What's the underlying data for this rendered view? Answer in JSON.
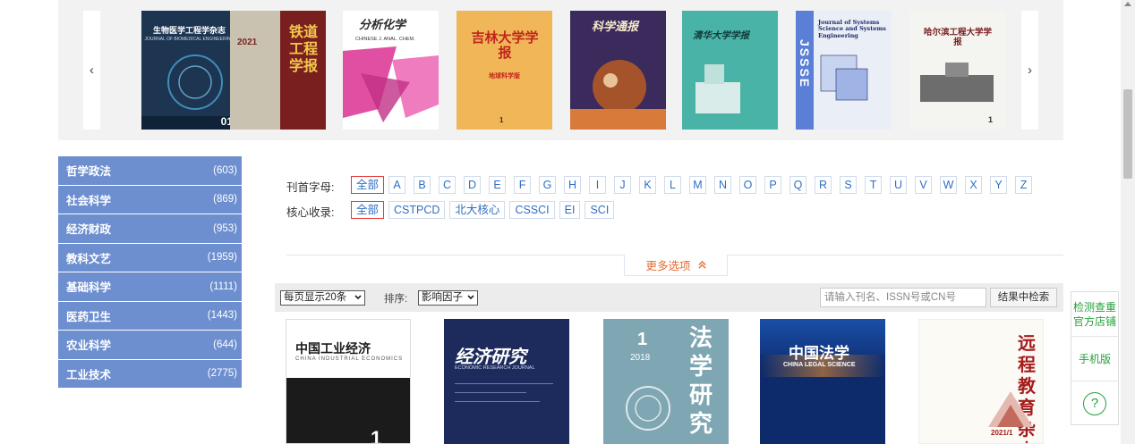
{
  "carousel": {
    "prev_icon": "chevron-left",
    "next_icon": "chevron-right",
    "prev_label": "‹",
    "next_label": "›",
    "covers": [
      {
        "title": "生物医学工程学杂志",
        "subtitle": "JOURNAL OF BIOMEDICAL ENGINEERING",
        "issue": "01",
        "bg": "#1d3550",
        "fg": "#ffffff"
      },
      {
        "title": "铁道工程学报",
        "subtitle": "2021",
        "issue": "",
        "bg": "#7a1f1f",
        "fg": "#f2c94c"
      },
      {
        "title": "分析化学",
        "subtitle": "CHINESE J. ANAL. CHEM.",
        "issue": "",
        "bg": "#e14fa2",
        "fg": "#2a2a2a"
      },
      {
        "title": "吉林大学学报",
        "subtitle": "地球科学版",
        "issue": "1",
        "bg": "#f0b657",
        "fg": "#c0261d"
      },
      {
        "title": "科学通报",
        "subtitle": "",
        "issue": "",
        "bg": "#3b2a5c",
        "fg": "#f5e9c9"
      },
      {
        "title": "清华大学学报",
        "subtitle": "",
        "issue": "",
        "bg": "#4ab3a7",
        "fg": "#0d3b3a"
      },
      {
        "title": "Journal of Systems Science and Systems Engineering",
        "subtitle": "JSSSE",
        "issue": "",
        "bg": "#e9eef7",
        "fg": "#1d2a66"
      },
      {
        "title": "哈尔滨工程大学学报",
        "subtitle": "",
        "issue": "1",
        "bg": "#f4f4f0",
        "fg": "#7a1f1f"
      }
    ]
  },
  "sidebar": {
    "categories": [
      {
        "name": "哲学政法",
        "count": "(603)"
      },
      {
        "name": "社会科学",
        "count": "(869)"
      },
      {
        "name": "经济财政",
        "count": "(953)"
      },
      {
        "name": "教科文艺",
        "count": "(1959)"
      },
      {
        "name": "基础科学",
        "count": "(1111)"
      },
      {
        "name": "医药卫生",
        "count": "(1443)"
      },
      {
        "name": "农业科学",
        "count": "(644)"
      },
      {
        "name": "工业技术",
        "count": "(2775)"
      }
    ]
  },
  "filters": {
    "letter_label": "刊首字母:",
    "letter_all": "全部",
    "letters": [
      "A",
      "B",
      "C",
      "D",
      "E",
      "F",
      "G",
      "H",
      "I",
      "J",
      "K",
      "L",
      "M",
      "N",
      "O",
      "P",
      "Q",
      "R",
      "S",
      "T",
      "U",
      "V",
      "W",
      "X",
      "Y",
      "Z"
    ],
    "core_label": "核心收录:",
    "core_all": "全部",
    "core_options": [
      "CSTPCD",
      "北大核心",
      "CSSCI",
      "EI",
      "SCI"
    ],
    "more_label": "更多选项",
    "more_icon": "double-chevron-up"
  },
  "toolbar": {
    "per_page": "每页显示20条",
    "sort_label": "排序:",
    "sort_value": "影响因子",
    "search_placeholder": "请输入刊名、ISSN号或CN号",
    "search_button": "结果中检索"
  },
  "results": [
    {
      "title": "中国工业经济",
      "subtitle": "CHINA INDUSTRIAL ECONOMICS",
      "issue": "1",
      "bg": "#ffffff",
      "fg": "#1a1a1a"
    },
    {
      "title": "经济研究",
      "subtitle": "ECONOMIC RESEARCH JOURNAL",
      "issue": "",
      "bg": "#1d2b5c",
      "fg": "#ffffff"
    },
    {
      "title": "法学研究",
      "subtitle": "2018",
      "issue": "1",
      "bg": "#7fa6b3",
      "fg": "#ffffff"
    },
    {
      "title": "中国法学",
      "subtitle": "CHINA LEGAL SCIENCE",
      "issue": "",
      "bg": "#0d2a6b",
      "fg": "#ffffff"
    },
    {
      "title": "远程教育杂志",
      "subtitle": "2021/1",
      "issue": "",
      "bg": "#fbfaf5",
      "fg": "#a61b1b"
    }
  ],
  "float_panel": {
    "shop": "检测查重 官方店铺",
    "mobile": "手机版",
    "help_icon": "?"
  }
}
